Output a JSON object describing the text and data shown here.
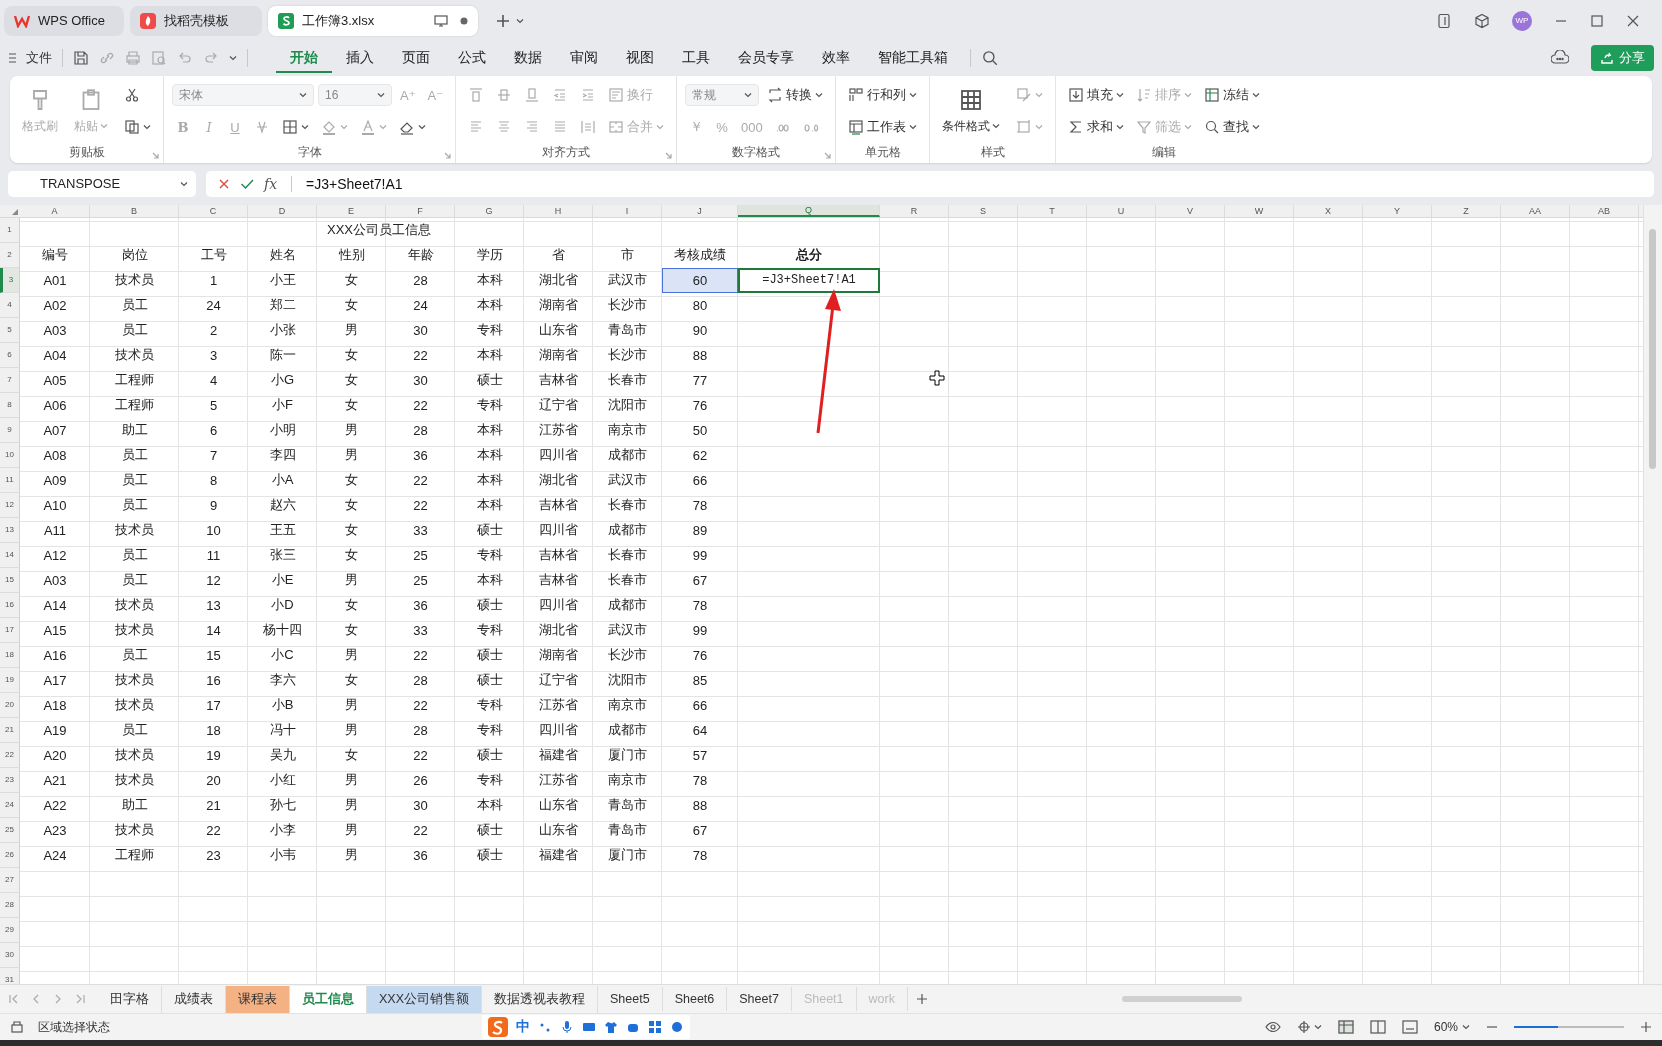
{
  "window": {
    "tabs": [
      {
        "label": "WPS Office",
        "kind": "home",
        "selected": false
      },
      {
        "label": "找稻壳模板",
        "kind": "template",
        "selected": false
      },
      {
        "label": "工作簿3.xlsx",
        "kind": "sheet",
        "selected": true
      }
    ],
    "avatar": "WP"
  },
  "menu": {
    "file": "文件",
    "items": [
      {
        "label": "开始",
        "selected": true
      },
      {
        "label": "插入",
        "selected": false
      },
      {
        "label": "页面",
        "selected": false
      },
      {
        "label": "公式",
        "selected": false
      },
      {
        "label": "数据",
        "selected": false
      },
      {
        "label": "审阅",
        "selected": false
      },
      {
        "label": "视图",
        "selected": false
      },
      {
        "label": "工具",
        "selected": false
      },
      {
        "label": "会员专享",
        "selected": false
      },
      {
        "label": "效率",
        "selected": false
      },
      {
        "label": "智能工具箱",
        "selected": false
      }
    ],
    "share": "分享"
  },
  "ribbon": [
    {
      "label": "剪贴板",
      "blocks": [
        {
          "kind": "large",
          "label": "格式刷",
          "disabled": true,
          "dropdown": false
        },
        {
          "kind": "large",
          "label": "粘贴",
          "disabled": true,
          "dropdown": true
        },
        {
          "kind": "rows",
          "rows": [
            [
              {
                "kind": "button",
                "disabled": false,
                "dropdown": false
              }
            ],
            [
              {
                "kind": "button",
                "disabled": false,
                "dropdown": true
              }
            ]
          ]
        }
      ]
    },
    {
      "label": "字体",
      "blocks": [
        {
          "kind": "rows",
          "rows": [
            [
              {
                "kind": "select",
                "value": "宋体",
                "wide": true
              },
              {
                "kind": "select",
                "value": "16",
                "wide": false
              },
              {
                "kind": "text",
                "label": "A⁺",
                "disabled": true
              },
              {
                "kind": "text",
                "label": "A⁻",
                "disabled": true
              }
            ],
            [
              {
                "kind": "bold",
                "label": "B",
                "disabled": true
              },
              {
                "kind": "italic",
                "label": "I",
                "disabled": true
              },
              {
                "kind": "underline",
                "label": "U",
                "disabled": true
              },
              {
                "kind": "button",
                "disabled": true,
                "dropdown": false
              },
              {
                "kind": "button",
                "disabled": false,
                "dropdown": true
              },
              {
                "kind": "button",
                "disabled": true,
                "dropdown": true
              },
              {
                "kind": "button",
                "disabled": true,
                "dropdown": true
              },
              {
                "kind": "button",
                "disabled": false,
                "dropdown": true
              }
            ]
          ]
        }
      ]
    },
    {
      "label": "对齐方式",
      "blocks": [
        {
          "kind": "rows",
          "rows": [
            [
              {
                "kind": "button",
                "disabled": true,
                "dropdown": false
              },
              {
                "kind": "button",
                "disabled": true,
                "dropdown": false
              },
              {
                "kind": "button",
                "disabled": true,
                "dropdown": false
              },
              {
                "kind": "button",
                "disabled": true,
                "dropdown": false
              },
              {
                "kind": "button",
                "disabled": true,
                "dropdown": false
              },
              {
                "kind": "button",
                "label": "换行",
                "disabled": true,
                "dropdown": false
              }
            ],
            [
              {
                "kind": "button",
                "disabled": true,
                "dropdown": false
              },
              {
                "kind": "button",
                "disabled": true,
                "dropdown": false
              },
              {
                "kind": "button",
                "disabled": true,
                "dropdown": false
              },
              {
                "kind": "button",
                "disabled": true,
                "dropdown": false
              },
              {
                "kind": "button",
                "disabled": true,
                "dropdown": false
              },
              {
                "kind": "button",
                "label": "合并",
                "disabled": true,
                "dropdown": true
              }
            ]
          ]
        }
      ]
    },
    {
      "label": "数字格式",
      "blocks": [
        {
          "kind": "rows",
          "rows": [
            [
              {
                "kind": "select",
                "value": "常规",
                "wide": false
              },
              {
                "kind": "button",
                "label": "转换",
                "disabled": false,
                "dropdown": true
              }
            ],
            [
              {
                "kind": "text",
                "label": "￥",
                "disabled": true
              },
              {
                "kind": "text",
                "label": "%",
                "disabled": true
              },
              {
                "kind": "text",
                "label": "000",
                "disabled": true
              },
              {
                "kind": "button",
                "disabled": true,
                "dropdown": false
              },
              {
                "kind": "button",
                "disabled": true,
                "dropdown": false
              }
            ]
          ]
        }
      ]
    },
    {
      "label": "单元格",
      "blocks": [
        {
          "kind": "rows",
          "rows": [
            [
              {
                "kind": "button",
                "label": "行和列",
                "disabled": false,
                "dropdown": true
              }
            ],
            [
              {
                "kind": "button",
                "label": "工作表",
                "disabled": false,
                "dropdown": true
              }
            ]
          ]
        }
      ]
    },
    {
      "label": "样式",
      "blocks": [
        {
          "kind": "large",
          "label": "条件格式",
          "disabled": false,
          "dropdown": true
        },
        {
          "kind": "rows",
          "rows": [
            [
              {
                "kind": "button",
                "disabled": true,
                "dropdown": true
              }
            ],
            [
              {
                "kind": "button",
                "disabled": true,
                "dropdown": true
              }
            ]
          ]
        }
      ]
    },
    {
      "label": "编辑",
      "blocks": [
        {
          "kind": "rows",
          "rows": [
            [
              {
                "kind": "button",
                "label": "填充",
                "disabled": false,
                "dropdown": true
              },
              {
                "kind": "button",
                "label": "排序",
                "disabled": true,
                "dropdown": true
              },
              {
                "kind": "button",
                "label": "冻结",
                "disabled": false,
                "dropdown": true
              }
            ],
            [
              {
                "kind": "button",
                "label": "求和",
                "disabled": false,
                "dropdown": true
              },
              {
                "kind": "button",
                "label": "筛选",
                "disabled": true,
                "dropdown": true
              },
              {
                "kind": "button",
                "label": "查找",
                "disabled": false,
                "dropdown": true
              }
            ]
          ]
        }
      ]
    }
  ],
  "formula_bar": {
    "name_box": "TRANSPOSE",
    "fx": "fx",
    "formula": "=J3+Sheet7!A1"
  },
  "sheet": {
    "columns": [
      {
        "label": "A",
        "selected": false
      },
      {
        "label": "B",
        "selected": false
      },
      {
        "label": "C",
        "selected": false
      },
      {
        "label": "D",
        "selected": false
      },
      {
        "label": "E",
        "selected": false
      },
      {
        "label": "F",
        "selected": false
      },
      {
        "label": "G",
        "selected": false
      },
      {
        "label": "H",
        "selected": false
      },
      {
        "label": "I",
        "selected": false
      },
      {
        "label": "J",
        "selected": false
      },
      {
        "label": "Q",
        "selected": true
      },
      {
        "label": "R",
        "selected": false
      },
      {
        "label": "S",
        "selected": false
      },
      {
        "label": "T",
        "selected": false
      },
      {
        "label": "U",
        "selected": false
      },
      {
        "label": "V",
        "selected": false
      },
      {
        "label": "W",
        "selected": false
      },
      {
        "label": "X",
        "selected": false
      },
      {
        "label": "Y",
        "selected": false
      },
      {
        "label": "Z",
        "selected": false
      },
      {
        "label": "AA",
        "selected": false
      },
      {
        "label": "AB",
        "selected": false
      }
    ],
    "row_numbers": [
      {
        "label": "1",
        "selected": false
      },
      {
        "label": "2",
        "selected": false
      },
      {
        "label": "3",
        "selected": true
      },
      {
        "label": "4",
        "selected": false
      },
      {
        "label": "5",
        "selected": false
      },
      {
        "label": "6",
        "selected": false
      },
      {
        "label": "7",
        "selected": false
      },
      {
        "label": "8",
        "selected": false
      },
      {
        "label": "9",
        "selected": false
      },
      {
        "label": "10",
        "selected": false
      },
      {
        "label": "11",
        "selected": false
      },
      {
        "label": "12",
        "selected": false
      },
      {
        "label": "13",
        "selected": false
      },
      {
        "label": "14",
        "selected": false
      },
      {
        "label": "15",
        "selected": false
      },
      {
        "label": "16",
        "selected": false
      },
      {
        "label": "17",
        "selected": false
      },
      {
        "label": "18",
        "selected": false
      },
      {
        "label": "19",
        "selected": false
      },
      {
        "label": "20",
        "selected": false
      },
      {
        "label": "21",
        "selected": false
      },
      {
        "label": "22",
        "selected": false
      },
      {
        "label": "23",
        "selected": false
      },
      {
        "label": "24",
        "selected": false
      },
      {
        "label": "25",
        "selected": false
      },
      {
        "label": "26",
        "selected": false
      },
      {
        "label": "27",
        "selected": false
      },
      {
        "label": "28",
        "selected": false
      },
      {
        "label": "29",
        "selected": false
      },
      {
        "label": "30",
        "selected": false
      },
      {
        "label": "31",
        "selected": false
      }
    ],
    "title": "XXX公司员工信息",
    "headers": [
      "编号",
      "岗位",
      "工号",
      "姓名",
      "性别",
      "年龄",
      "学历",
      "省",
      "市",
      "考核成绩"
    ],
    "total_header": "总分",
    "rows": [
      {
        "cells": [
          "A01",
          "技术员",
          "1",
          "小王",
          "女",
          "28",
          "本科",
          "湖北省",
          "武汉市",
          "60"
        ],
        "score_referenced": true,
        "total": {
          "text": "=J3+Sheet7!A1",
          "editing": true
        }
      },
      {
        "cells": [
          "A02",
          "员工",
          "24",
          "郑二",
          "女",
          "24",
          "本科",
          "湖南省",
          "长沙市",
          "80"
        ],
        "score_referenced": false
      },
      {
        "cells": [
          "A03",
          "员工",
          "2",
          "小张",
          "男",
          "30",
          "专科",
          "山东省",
          "青岛市",
          "90"
        ],
        "score_referenced": false
      },
      {
        "cells": [
          "A04",
          "技术员",
          "3",
          "陈一",
          "女",
          "22",
          "本科",
          "湖南省",
          "长沙市",
          "88"
        ],
        "score_referenced": false
      },
      {
        "cells": [
          "A05",
          "工程师",
          "4",
          "小G",
          "女",
          "30",
          "硕士",
          "吉林省",
          "长春市",
          "77"
        ],
        "score_referenced": false
      },
      {
        "cells": [
          "A06",
          "工程师",
          "5",
          "小F",
          "女",
          "22",
          "专科",
          "辽宁省",
          "沈阳市",
          "76"
        ],
        "score_referenced": false
      },
      {
        "cells": [
          "A07",
          "助工",
          "6",
          "小明",
          "男",
          "28",
          "本科",
          "江苏省",
          "南京市",
          "50"
        ],
        "score_referenced": false
      },
      {
        "cells": [
          "A08",
          "员工",
          "7",
          "李四",
          "男",
          "36",
          "本科",
          "四川省",
          "成都市",
          "62"
        ],
        "score_referenced": false
      },
      {
        "cells": [
          "A09",
          "员工",
          "8",
          "小A",
          "女",
          "22",
          "本科",
          "湖北省",
          "武汉市",
          "66"
        ],
        "score_referenced": false
      },
      {
        "cells": [
          "A10",
          "员工",
          "9",
          "赵六",
          "女",
          "22",
          "本科",
          "吉林省",
          "长春市",
          "78"
        ],
        "score_referenced": false
      },
      {
        "cells": [
          "A11",
          "技术员",
          "10",
          "王五",
          "女",
          "33",
          "硕士",
          "四川省",
          "成都市",
          "89"
        ],
        "score_referenced": false
      },
      {
        "cells": [
          "A12",
          "员工",
          "11",
          "张三",
          "女",
          "25",
          "专科",
          "吉林省",
          "长春市",
          "99"
        ],
        "score_referenced": false
      },
      {
        "cells": [
          "A03",
          "员工",
          "12",
          "小E",
          "男",
          "25",
          "本科",
          "吉林省",
          "长春市",
          "67"
        ],
        "score_referenced": false
      },
      {
        "cells": [
          "A14",
          "技术员",
          "13",
          "小D",
          "女",
          "36",
          "硕士",
          "四川省",
          "成都市",
          "78"
        ],
        "score_referenced": false
      },
      {
        "cells": [
          "A15",
          "技术员",
          "14",
          "杨十四",
          "女",
          "33",
          "专科",
          "湖北省",
          "武汉市",
          "99"
        ],
        "score_referenced": false
      },
      {
        "cells": [
          "A16",
          "员工",
          "15",
          "小C",
          "男",
          "22",
          "硕士",
          "湖南省",
          "长沙市",
          "76"
        ],
        "score_referenced": false
      },
      {
        "cells": [
          "A17",
          "技术员",
          "16",
          "李六",
          "女",
          "28",
          "硕士",
          "辽宁省",
          "沈阳市",
          "85"
        ],
        "score_referenced": false
      },
      {
        "cells": [
          "A18",
          "技术员",
          "17",
          "小B",
          "男",
          "22",
          "专科",
          "江苏省",
          "南京市",
          "66"
        ],
        "score_referenced": false
      },
      {
        "cells": [
          "A19",
          "员工",
          "18",
          "冯十",
          "男",
          "28",
          "专科",
          "四川省",
          "成都市",
          "64"
        ],
        "score_referenced": false
      },
      {
        "cells": [
          "A20",
          "技术员",
          "19",
          "吴九",
          "女",
          "22",
          "硕士",
          "福建省",
          "厦门市",
          "57"
        ],
        "score_referenced": false
      },
      {
        "cells": [
          "A21",
          "技术员",
          "20",
          "小红",
          "男",
          "26",
          "专科",
          "江苏省",
          "南京市",
          "78"
        ],
        "score_referenced": false
      },
      {
        "cells": [
          "A22",
          "助工",
          "21",
          "孙七",
          "男",
          "30",
          "本科",
          "山东省",
          "青岛市",
          "88"
        ],
        "score_referenced": false
      },
      {
        "cells": [
          "A23",
          "技术员",
          "22",
          "小李",
          "男",
          "22",
          "硕士",
          "山东省",
          "青岛市",
          "67"
        ],
        "score_referenced": false
      },
      {
        "cells": [
          "A24",
          "工程师",
          "23",
          "小韦",
          "男",
          "36",
          "硕士",
          "福建省",
          "厦门市",
          "78"
        ],
        "score_referenced": false
      }
    ]
  },
  "sheet_tabs": [
    {
      "label": "田字格",
      "selected": false,
      "hidden": false
    },
    {
      "label": "成绩表",
      "selected": false,
      "hidden": false
    },
    {
      "label": "课程表",
      "selected": false,
      "hidden": false,
      "color": "#f4b183"
    },
    {
      "label": "员工信息",
      "selected": true,
      "hidden": false
    },
    {
      "label": "XXX公司销售额",
      "selected": false,
      "hidden": false,
      "color": "#c5d9f1"
    },
    {
      "label": "数据透视表教程",
      "selected": false,
      "hidden": false
    },
    {
      "label": "Sheet5",
      "selected": false,
      "hidden": false
    },
    {
      "label": "Sheet6",
      "selected": false,
      "hidden": false
    },
    {
      "label": "Sheet7",
      "selected": false,
      "hidden": false
    },
    {
      "label": "Sheet1",
      "selected": false,
      "hidden": true
    },
    {
      "label": "work",
      "selected": false,
      "hidden": true
    }
  ],
  "status_bar": {
    "mode": "区域选择状态",
    "ime": "中",
    "zoom": "60%",
    "zoom_slider": {
      "level": 0.4
    }
  }
}
